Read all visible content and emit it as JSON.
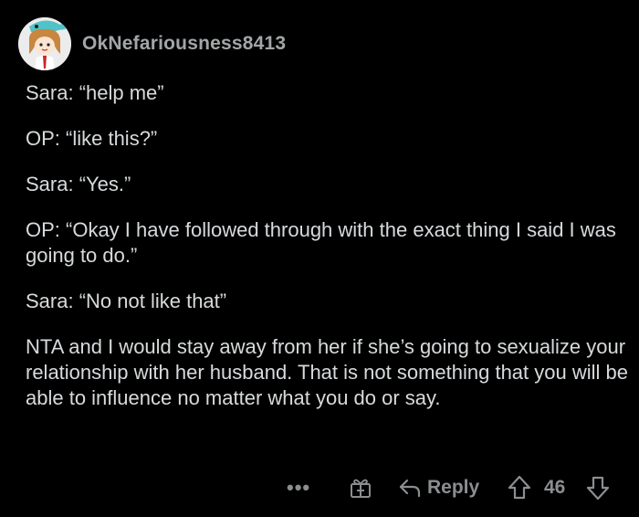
{
  "comment": {
    "username": "OkNefariousness8413",
    "paragraphs": [
      "Sara: “help me”",
      "OP: “like this?”",
      "Sara: “Yes.”",
      "OP: “Okay I have followed through with the exact thing I said I was going to do.”",
      "Sara: “No not like that”",
      "NTA and I would stay away from her if she’s going to sexualize your relationship with her husband. That is not something that you will be able to influence no matter what you do or say."
    ]
  },
  "actions": {
    "more_label": "•••",
    "reply_label": "Reply",
    "score": "46"
  },
  "icons": {
    "more": "more-options-icon",
    "award": "gift-award-icon",
    "reply": "reply-arrow-icon",
    "upvote": "upvote-arrow-icon",
    "downvote": "downvote-arrow-icon"
  },
  "colors": {
    "background": "#000000",
    "text": "#d7dadc",
    "muted": "#8b8e90",
    "username": "#a3a6a8"
  }
}
